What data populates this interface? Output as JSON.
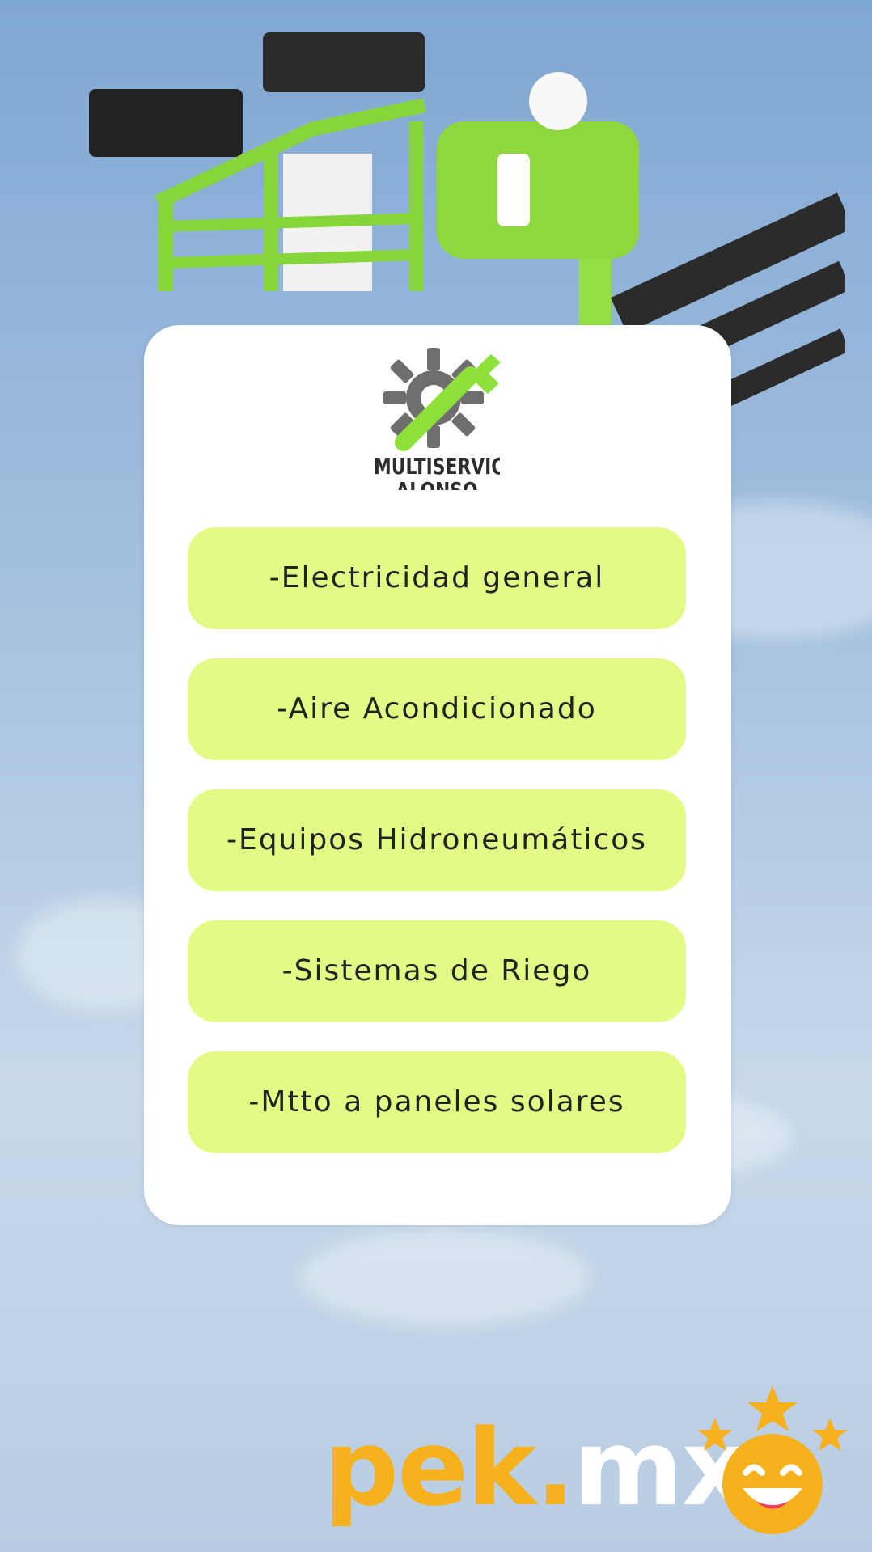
{
  "brand": {
    "name": "MULTISERVICIOS ALONSO",
    "colors": {
      "gear": "#6e6e6e",
      "wrench": "#8ee03a"
    }
  },
  "services": [
    {
      "label": "-Electricidad general"
    },
    {
      "label": "-Aire Acondicionado"
    },
    {
      "label": "-Equipos Hidroneumáticos"
    },
    {
      "label": "-Sistemas de Riego"
    },
    {
      "label": "-Mtto a paneles solares"
    }
  ],
  "watermark": {
    "part1": "pek",
    "part2": ".",
    "part3": "mx",
    "icon": "smiley-stars-icon"
  },
  "theme": {
    "card_bg": "#ffffff",
    "pill_bg": "#e3fb85",
    "text": "#222222"
  }
}
